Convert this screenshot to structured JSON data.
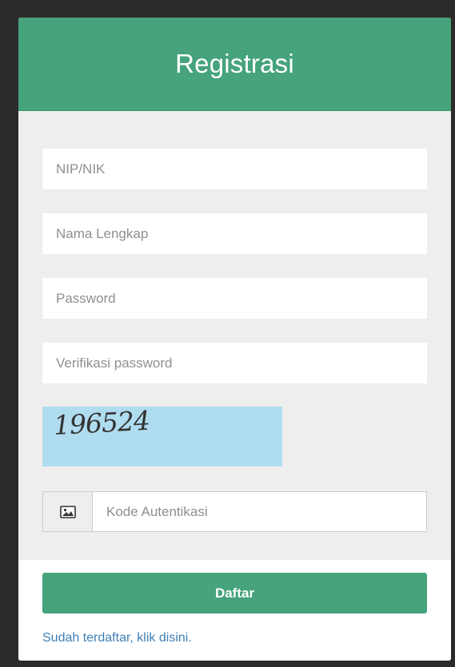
{
  "colors": {
    "brand_green": "#46a37b",
    "link_blue": "#3f7fb7",
    "captcha_bg": "#b0dcef"
  },
  "header": {
    "title": "Registrasi"
  },
  "form": {
    "nip_placeholder": "NIP/NIK",
    "name_placeholder": "Nama Lengkap",
    "password_placeholder": "Password",
    "verify_password_placeholder": "Verifikasi password",
    "captcha_text": "196524",
    "auth_icon": "image-icon",
    "auth_code_placeholder": "Kode Autentikasi"
  },
  "footer": {
    "submit_label": "Daftar",
    "login_link": "Sudah terdaftar, klik disini."
  }
}
